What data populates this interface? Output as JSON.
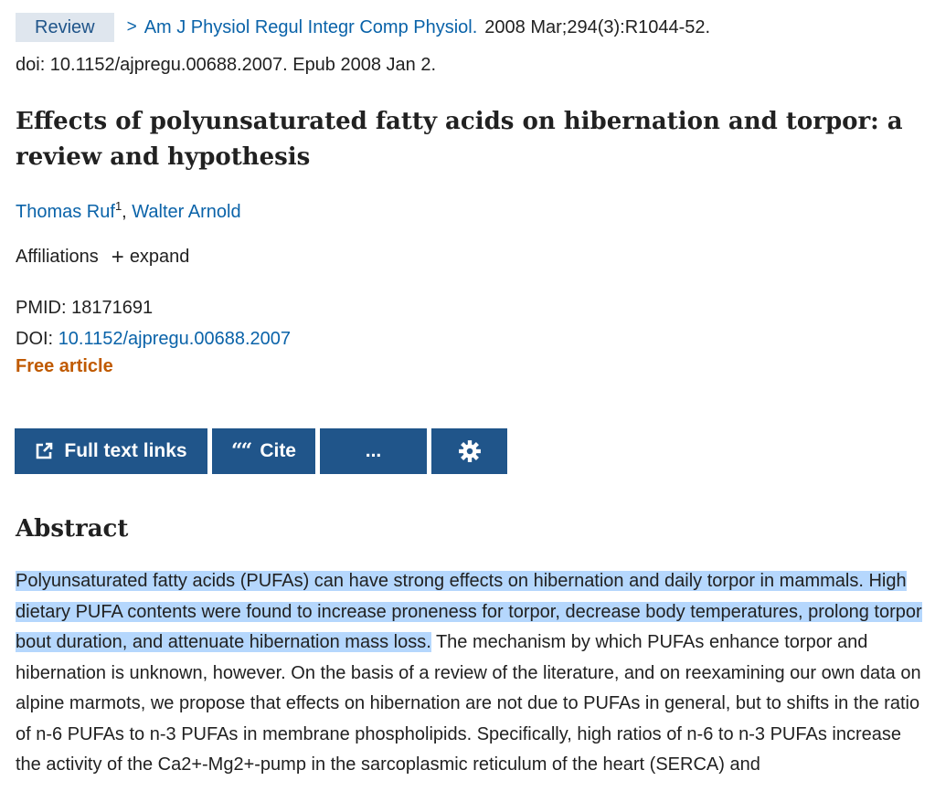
{
  "header": {
    "badge": "Review",
    "chevron": ">",
    "journal": "Am J Physiol Regul Integr Comp Physiol.",
    "citation": "2008 Mar;294(3):R1044-52.",
    "doi_epub": "doi: 10.1152/ajpregu.00688.2007. Epub 2008 Jan 2."
  },
  "title": "Effects of polyunsaturated fatty acids on hibernation and torpor: a review and hypothesis",
  "authors": [
    {
      "name": "Thomas Ruf",
      "sup": "1"
    },
    {
      "name": "Walter Arnold"
    }
  ],
  "author_sep": ",",
  "affiliations": {
    "label": "Affiliations",
    "plus": "+",
    "toggle": "expand"
  },
  "ids": {
    "pmid_label": "PMID:",
    "pmid": "18171691",
    "doi_label": "DOI:",
    "doi": "10.1152/ajpregu.00688.2007"
  },
  "free_article": "Free article",
  "actions": {
    "full_text": "Full text links",
    "cite_quote": "““",
    "cite": "Cite",
    "more": "...",
    "settings_icon": "gear-icon"
  },
  "abstract": {
    "heading": "Abstract",
    "highlighted": "Polyunsaturated fatty acids (PUFAs) can have strong effects on hibernation and daily torpor in mammals. High dietary PUFA contents were found to increase proneness for torpor, decrease body temperatures, prolong torpor bout duration, and attenuate hibernation mass loss.",
    "rest": " The mechanism by which PUFAs enhance torpor and hibernation is unknown, however. On the basis of a review of the literature, and on reexamining our own data on alpine marmots, we propose that effects on hibernation are not due to PUFAs in general, but to shifts in the ratio of n-6 PUFAs to n-3 PUFAs in membrane phospholipids. Specifically, high ratios of n-6 to n-3 PUFAs increase the activity of the Ca2+-Mg2+-pump in the sarcoplasmic reticulum of the heart (SERCA) and"
  },
  "colors": {
    "link": "#0a63a9",
    "button": "#20558a",
    "badge_bg": "#dfe6ee",
    "free": "#c05a00",
    "highlight": "#b5d7fd"
  }
}
